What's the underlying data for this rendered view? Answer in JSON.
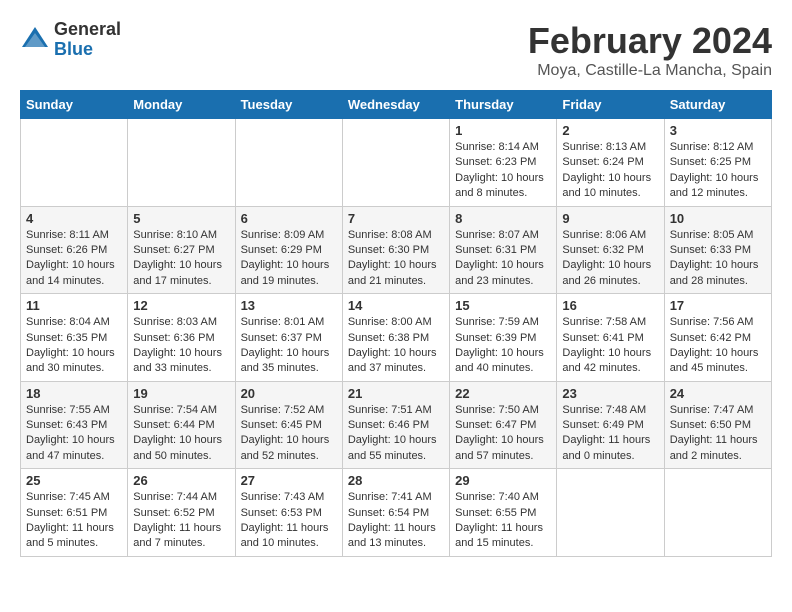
{
  "logo": {
    "general": "General",
    "blue": "Blue"
  },
  "title": "February 2024",
  "location": "Moya, Castille-La Mancha, Spain",
  "weekdays": [
    "Sunday",
    "Monday",
    "Tuesday",
    "Wednesday",
    "Thursday",
    "Friday",
    "Saturday"
  ],
  "weeks": [
    [
      {
        "day": "",
        "info": ""
      },
      {
        "day": "",
        "info": ""
      },
      {
        "day": "",
        "info": ""
      },
      {
        "day": "",
        "info": ""
      },
      {
        "day": "1",
        "info": "Sunrise: 8:14 AM\nSunset: 6:23 PM\nDaylight: 10 hours\nand 8 minutes."
      },
      {
        "day": "2",
        "info": "Sunrise: 8:13 AM\nSunset: 6:24 PM\nDaylight: 10 hours\nand 10 minutes."
      },
      {
        "day": "3",
        "info": "Sunrise: 8:12 AM\nSunset: 6:25 PM\nDaylight: 10 hours\nand 12 minutes."
      }
    ],
    [
      {
        "day": "4",
        "info": "Sunrise: 8:11 AM\nSunset: 6:26 PM\nDaylight: 10 hours\nand 14 minutes."
      },
      {
        "day": "5",
        "info": "Sunrise: 8:10 AM\nSunset: 6:27 PM\nDaylight: 10 hours\nand 17 minutes."
      },
      {
        "day": "6",
        "info": "Sunrise: 8:09 AM\nSunset: 6:29 PM\nDaylight: 10 hours\nand 19 minutes."
      },
      {
        "day": "7",
        "info": "Sunrise: 8:08 AM\nSunset: 6:30 PM\nDaylight: 10 hours\nand 21 minutes."
      },
      {
        "day": "8",
        "info": "Sunrise: 8:07 AM\nSunset: 6:31 PM\nDaylight: 10 hours\nand 23 minutes."
      },
      {
        "day": "9",
        "info": "Sunrise: 8:06 AM\nSunset: 6:32 PM\nDaylight: 10 hours\nand 26 minutes."
      },
      {
        "day": "10",
        "info": "Sunrise: 8:05 AM\nSunset: 6:33 PM\nDaylight: 10 hours\nand 28 minutes."
      }
    ],
    [
      {
        "day": "11",
        "info": "Sunrise: 8:04 AM\nSunset: 6:35 PM\nDaylight: 10 hours\nand 30 minutes."
      },
      {
        "day": "12",
        "info": "Sunrise: 8:03 AM\nSunset: 6:36 PM\nDaylight: 10 hours\nand 33 minutes."
      },
      {
        "day": "13",
        "info": "Sunrise: 8:01 AM\nSunset: 6:37 PM\nDaylight: 10 hours\nand 35 minutes."
      },
      {
        "day": "14",
        "info": "Sunrise: 8:00 AM\nSunset: 6:38 PM\nDaylight: 10 hours\nand 37 minutes."
      },
      {
        "day": "15",
        "info": "Sunrise: 7:59 AM\nSunset: 6:39 PM\nDaylight: 10 hours\nand 40 minutes."
      },
      {
        "day": "16",
        "info": "Sunrise: 7:58 AM\nSunset: 6:41 PM\nDaylight: 10 hours\nand 42 minutes."
      },
      {
        "day": "17",
        "info": "Sunrise: 7:56 AM\nSunset: 6:42 PM\nDaylight: 10 hours\nand 45 minutes."
      }
    ],
    [
      {
        "day": "18",
        "info": "Sunrise: 7:55 AM\nSunset: 6:43 PM\nDaylight: 10 hours\nand 47 minutes."
      },
      {
        "day": "19",
        "info": "Sunrise: 7:54 AM\nSunset: 6:44 PM\nDaylight: 10 hours\nand 50 minutes."
      },
      {
        "day": "20",
        "info": "Sunrise: 7:52 AM\nSunset: 6:45 PM\nDaylight: 10 hours\nand 52 minutes."
      },
      {
        "day": "21",
        "info": "Sunrise: 7:51 AM\nSunset: 6:46 PM\nDaylight: 10 hours\nand 55 minutes."
      },
      {
        "day": "22",
        "info": "Sunrise: 7:50 AM\nSunset: 6:47 PM\nDaylight: 10 hours\nand 57 minutes."
      },
      {
        "day": "23",
        "info": "Sunrise: 7:48 AM\nSunset: 6:49 PM\nDaylight: 11 hours\nand 0 minutes."
      },
      {
        "day": "24",
        "info": "Sunrise: 7:47 AM\nSunset: 6:50 PM\nDaylight: 11 hours\nand 2 minutes."
      }
    ],
    [
      {
        "day": "25",
        "info": "Sunrise: 7:45 AM\nSunset: 6:51 PM\nDaylight: 11 hours\nand 5 minutes."
      },
      {
        "day": "26",
        "info": "Sunrise: 7:44 AM\nSunset: 6:52 PM\nDaylight: 11 hours\nand 7 minutes."
      },
      {
        "day": "27",
        "info": "Sunrise: 7:43 AM\nSunset: 6:53 PM\nDaylight: 11 hours\nand 10 minutes."
      },
      {
        "day": "28",
        "info": "Sunrise: 7:41 AM\nSunset: 6:54 PM\nDaylight: 11 hours\nand 13 minutes."
      },
      {
        "day": "29",
        "info": "Sunrise: 7:40 AM\nSunset: 6:55 PM\nDaylight: 11 hours\nand 15 minutes."
      },
      {
        "day": "",
        "info": ""
      },
      {
        "day": "",
        "info": ""
      }
    ]
  ]
}
